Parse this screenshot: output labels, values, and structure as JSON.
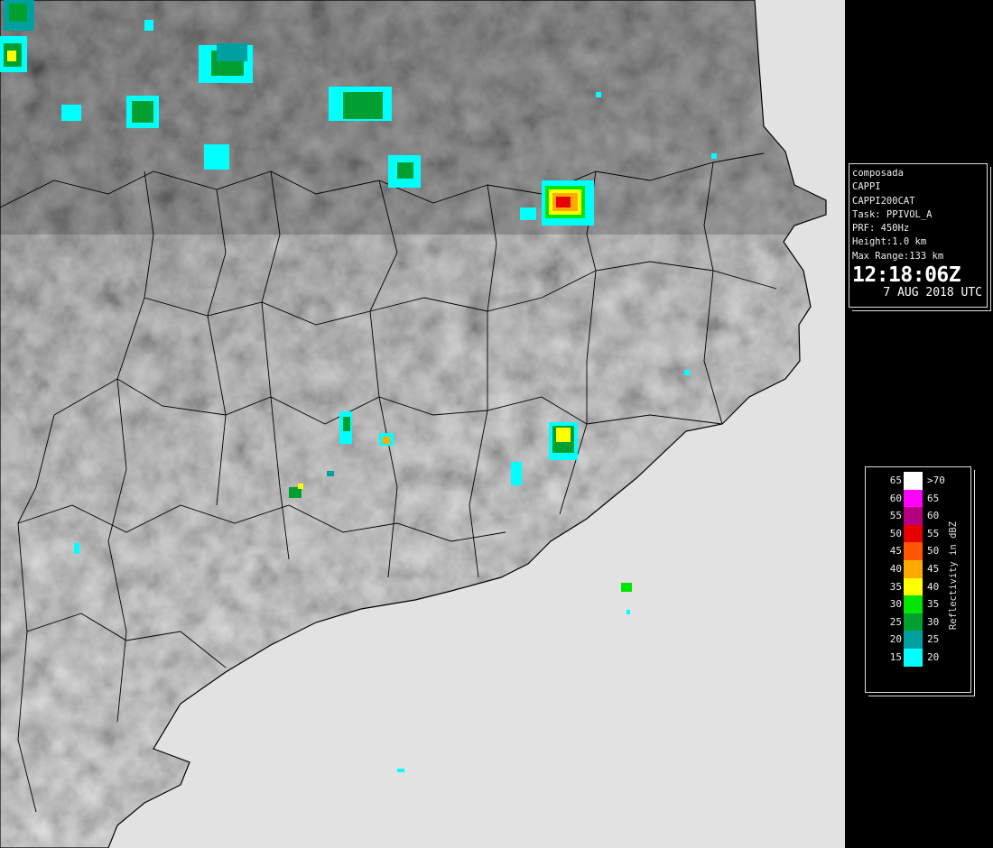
{
  "radar_info": {
    "product": "composada",
    "type": "CAPPI",
    "name": "CAPPI200CAT",
    "task": "Task: PPIVOL_A",
    "prf": "PRF: 450Hz",
    "height": "Height:1.0 km",
    "max_range": "Max Range:133 km",
    "time": "12:18:06Z",
    "date": "7 AUG 2018 UTC"
  },
  "legend": {
    "title": "Reflectivity in dBZ",
    "rows": [
      {
        "lo": "65",
        "hi": ">70",
        "color": "#ffffff"
      },
      {
        "lo": "60",
        "hi": "65",
        "color": "#ff00ff"
      },
      {
        "lo": "55",
        "hi": "60",
        "color": "#b40080"
      },
      {
        "lo": "50",
        "hi": "55",
        "color": "#e60000"
      },
      {
        "lo": "45",
        "hi": "50",
        "color": "#ff5500"
      },
      {
        "lo": "40",
        "hi": "45",
        "color": "#ffaa00"
      },
      {
        "lo": "35",
        "hi": "40",
        "color": "#ffff00"
      },
      {
        "lo": "30",
        "hi": "35",
        "color": "#00e600"
      },
      {
        "lo": "25",
        "hi": "30",
        "color": "#00a030"
      },
      {
        "lo": "20",
        "hi": "25",
        "color": "#00a0a0"
      },
      {
        "lo": "15",
        "hi": "20",
        "color": "#00ffff"
      }
    ]
  },
  "colors": {
    "sea": "#e2e2e2",
    "land_dark": "#5a5a5a",
    "land_mid": "#9a9a9a",
    "border": "#000000"
  }
}
